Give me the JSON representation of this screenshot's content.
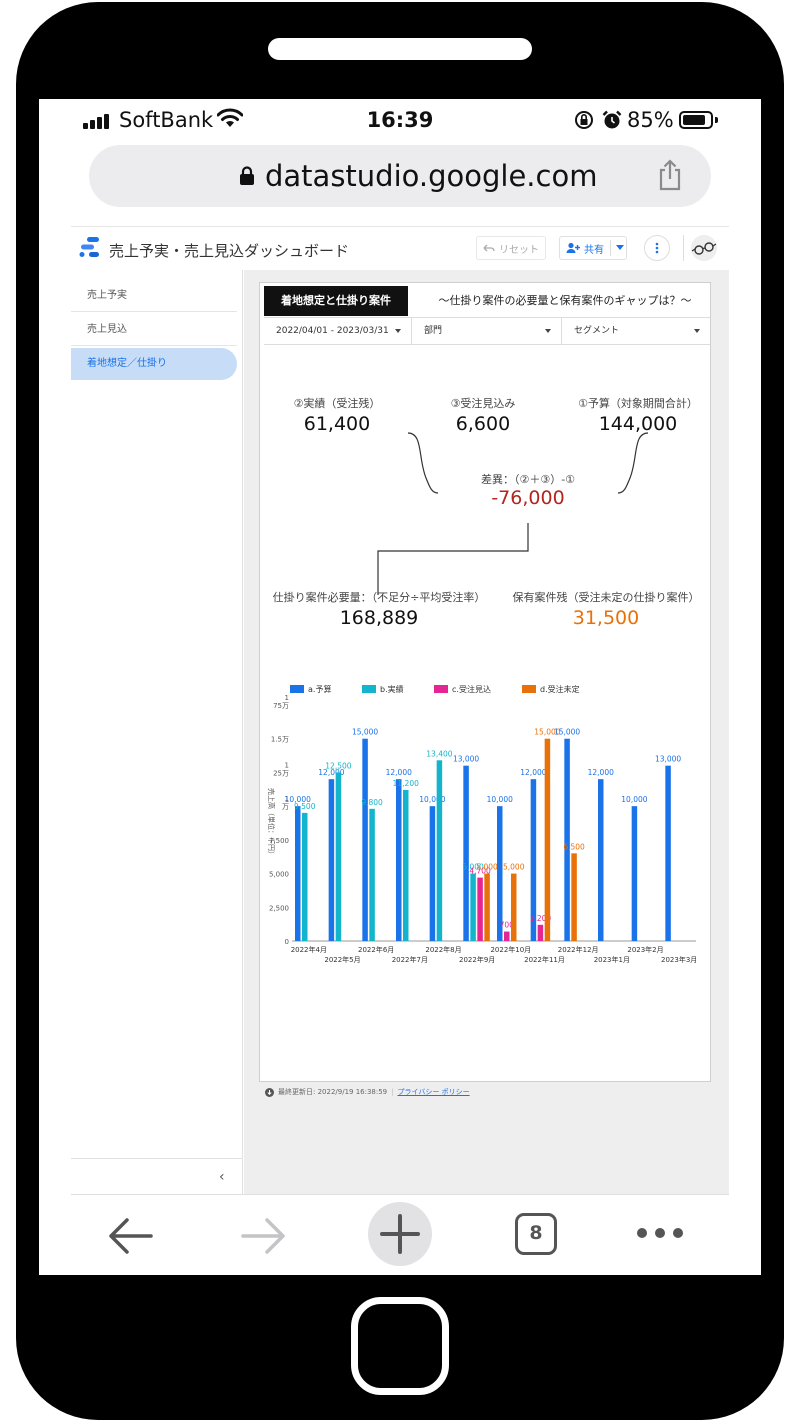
{
  "status_bar": {
    "carrier": "SoftBank",
    "time": "16:39",
    "battery_percent": "85%",
    "battery_level": 0.85
  },
  "browser": {
    "url": "datastudio.google.com",
    "tab_count": "8"
  },
  "report_header": {
    "title": "売上予実・売上見込ダッシュボード",
    "reset_label": "リセット",
    "share_label": "共有"
  },
  "sidebar": {
    "items": [
      {
        "label": "売上予実"
      },
      {
        "label": "売上見込"
      },
      {
        "label": "着地想定／仕掛り"
      }
    ],
    "collapse_glyph": "‹"
  },
  "report": {
    "tab_label": "着地想定と仕掛り案件",
    "subtitle": "～仕掛り案件の必要量と保有案件のギャップは？～",
    "filters": {
      "date_range": "2022/04/01 - 2023/03/31",
      "department": "部門",
      "segment": "セグメント"
    },
    "kpis": {
      "actual_label": "②実績（受注残）",
      "actual_value": "61,400",
      "forecast_label": "③受注見込み",
      "forecast_value": "6,600",
      "budget_label": "①予算（対象期間合計）",
      "budget_value": "144,000",
      "diff_label": "差異：（②＋③）-①",
      "diff_value": "-76,000",
      "required_label": "仕掛り案件必要量：（不足分÷平均受注率）",
      "required_value": "168,889",
      "pipeline_label": "保有案件残（受注未定の仕掛り案件）",
      "pipeline_value": "31,500"
    },
    "colors": {
      "diff": "#b3261e",
      "pipeline": "#e8710a"
    }
  },
  "footer": {
    "updated": "最終更新日: 2022/9/19 16:38:59",
    "privacy": "プライバシー ポリシー"
  },
  "chart_data": {
    "type": "bar",
    "ylabel": "売上高（単位：千円）",
    "y_ticks": [
      "0",
      "2,500",
      "5,000",
      "7,500",
      "1\n万",
      "1\n25万",
      "1.5万",
      "1\n75万"
    ],
    "ylim": [
      0,
      17500
    ],
    "categories": [
      "2022年4月",
      "2022年5月",
      "2022年6月",
      "2022年7月",
      "2022年8月",
      "2022年9月",
      "2022年10月",
      "2022年11月",
      "2022年12月",
      "2023年1月",
      "2023年2月",
      "2023年3月"
    ],
    "series": [
      {
        "name": "a.予算",
        "color": "#1a73e8",
        "values": [
          10000,
          12000,
          15000,
          12000,
          10000,
          13000,
          10000,
          12000,
          15000,
          12000,
          10000,
          13000
        ]
      },
      {
        "name": "b.実績",
        "color": "#12b5cb",
        "values": [
          9500,
          12500,
          9800,
          11200,
          13400,
          5000,
          null,
          null,
          null,
          null,
          null,
          null
        ]
      },
      {
        "name": "c.受注見込",
        "color": "#e52592",
        "values": [
          null,
          null,
          null,
          null,
          null,
          4700,
          700,
          1200,
          null,
          null,
          null,
          null
        ]
      },
      {
        "name": "d.受注未定",
        "color": "#e8710a",
        "values": [
          null,
          null,
          null,
          null,
          null,
          5000,
          5000,
          15000,
          6500,
          null,
          null,
          null
        ]
      }
    ],
    "data_labels": {
      "a.予算": [
        "10,000",
        "12,000",
        "15,000",
        "12,000",
        "10,000",
        "13,000",
        "10,000",
        "12,000",
        "15,000",
        "12,000",
        "10,000",
        "13,000"
      ],
      "b.実績": [
        "9,500",
        "12,500",
        "9,800",
        "11,200",
        "13,400",
        "5,000",
        "",
        "",
        "",
        "",
        "",
        ""
      ],
      "c.受注見込": [
        "",
        "",
        "",
        "",
        "",
        "4,700",
        "700",
        "1,200",
        "",
        "",
        "",
        ""
      ],
      "d.受注未定": [
        "",
        "",
        "",
        "",
        "",
        "5,000",
        "5,000",
        "15,000",
        "6,500",
        "",
        "",
        ""
      ]
    },
    "legend_position": "top-left"
  }
}
